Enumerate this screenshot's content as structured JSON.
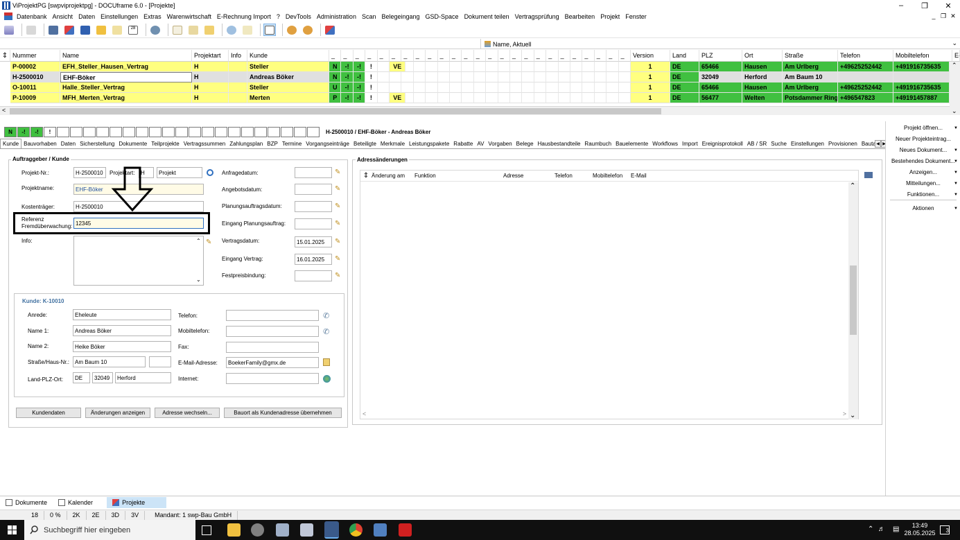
{
  "window": {
    "title": "ViProjektPG [swpviprojektpg] - DOCUframe 6.0 - [Projekte]"
  },
  "menu": [
    "Datenbank",
    "Ansicht",
    "Daten",
    "Einstellungen",
    "Extras",
    "Warenwirtschaft",
    "E-Rechnung Import",
    "?",
    "DevTools",
    "Administration",
    "Scan",
    "Belegeingang",
    "GSD-Space",
    "Dokument teilen",
    "Vertragsprüfung",
    "Bearbeiten",
    "Projekt",
    "Fenster"
  ],
  "view": {
    "selected": "Name, Aktuell"
  },
  "grid": {
    "columns": [
      "Nummer",
      "Name",
      "Projektart",
      "Info",
      "Kunde",
      "Version",
      "Land",
      "PLZ",
      "Ort",
      "Straße",
      "Telefon",
      "Mobiltelefon",
      "E-"
    ],
    "flagcols": [
      "_",
      "_",
      "_",
      "_",
      "_",
      "_",
      "_",
      "_",
      "_",
      "_",
      "_",
      "_",
      "_",
      "_",
      "_",
      "_",
      "_",
      "_",
      "_",
      "_",
      "_",
      "_",
      "_",
      "_",
      "_"
    ],
    "rows": [
      {
        "nummer": "P-00002",
        "name": "EFH_Steller_Hausen_Vertrag",
        "art": "H",
        "kunde": "Steller",
        "s1": "N",
        "s2": "-!",
        "s3": "-!",
        "s4": "!",
        "ve": "VE",
        "version": "1",
        "land": "DE",
        "plz": "65466",
        "ort": "Hausen",
        "strasse": "Am Urlberg",
        "telefon": "+49625252442",
        "mobil": "+491916735635"
      },
      {
        "nummer": "H-2500010",
        "name": "EHF-Böker",
        "art": "H",
        "kunde": "Andreas Böker",
        "s1": "N",
        "s2": "-!",
        "s3": "-!",
        "s4": "!",
        "ve": "",
        "version": "1",
        "land": "DE",
        "plz": "32049",
        "ort": "Herford",
        "strasse": "Am Baum 10",
        "telefon": "",
        "mobil": ""
      },
      {
        "nummer": "O-10011",
        "name": "Halle_Steller_Vertrag",
        "art": "H",
        "kunde": "Steller",
        "s1": "U",
        "s2": "-!",
        "s3": "-!",
        "s4": "!",
        "ve": "",
        "version": "1",
        "land": "DE",
        "plz": "65466",
        "ort": "Hausen",
        "strasse": "Am Urlberg",
        "telefon": "+49625252442",
        "mobil": "+491916735635"
      },
      {
        "nummer": "P-10009",
        "name": "MFH_Merten_Vertrag",
        "art": "H",
        "kunde": "Merten",
        "s1": "P",
        "s2": "-!",
        "s3": "-!",
        "s4": "!",
        "ve": "VE",
        "version": "1",
        "land": "DE",
        "plz": "56477",
        "ort": "Welten",
        "strasse": "Potsdammer Ring",
        "telefon": "+496547823",
        "mobil": "+49191457887"
      }
    ]
  },
  "status": {
    "flags": [
      "N",
      "-!",
      "-!",
      "!"
    ],
    "record": "H-2500010 / EHF-Böker - Andreas Böker"
  },
  "tabs": [
    "Kunde",
    "Bauvorhaben",
    "Daten",
    "Sicherstellung",
    "Dokumente",
    "Teilprojekte",
    "Vertragssummen",
    "Zahlungsplan",
    "BZP",
    "Termine",
    "Vorgangseinträge",
    "Beteiligte",
    "Merkmale",
    "Leistungspakete",
    "Rabatte",
    "AV",
    "Vorgaben",
    "Belege",
    "Hausbestandteile",
    "Raumbuch",
    "Bauelemente",
    "Workflows",
    "Import",
    "Ereignisprotokoll",
    "AB / SR",
    "Suche",
    "Einstellungen",
    "Provisionen",
    "Bautagebuch"
  ],
  "auftrag": {
    "title": "Auftraggeber / Kunde",
    "projektnr_label": "Projekt-Nr.:",
    "projektnr": "H-2500010",
    "projektart_label": "Projektart:",
    "projektart": "H",
    "projektart_name": "Projekt",
    "projektname_label": "Projektname:",
    "projektname": "EHF-Böker",
    "kostentraeger_label": "Kostenträger:",
    "kostentraeger": "H-2500010",
    "referenz_label1": "Referenz",
    "referenz_label2": "Fremdüberwachung:",
    "referenz": "12345",
    "info_label": "Info:",
    "anfrage_label": "Anfragedatum:",
    "anfrage": "",
    "angebot_label": "Angebotsdatum:",
    "angebot": "",
    "planung_label": "Planungsauftragsdatum:",
    "planung": "",
    "eingang_planung_label": "Eingang Planungsauftrag:",
    "eingang_planung": "",
    "vertrag_label": "Vertragsdatum:",
    "vertrag": "15.01.2025",
    "eingang_vertrag_label": "Eingang Vertrag:",
    "eingang_vertrag": "16.01.2025",
    "festpreis_label": "Festpreisbindung:",
    "festpreis": ""
  },
  "kunde": {
    "title": "Kunde: K-10010",
    "anrede_label": "Anrede:",
    "anrede": "Eheleute",
    "name1_label": "Name 1:",
    "name1": "Andreas Böker",
    "name2_label": "Name 2:",
    "name2": "Heike Böker",
    "strasse_label": "Straße/Haus-Nr.:",
    "strasse": "Am Baum 10",
    "hausnr": "",
    "lpo_label": "Land-PLZ-Ort:",
    "land": "DE",
    "plz": "32049",
    "ort": "Herford",
    "telefon_label": "Telefon:",
    "telefon": "",
    "mobil_label": "Mobiltelefon:",
    "mobil": "",
    "fax_label": "Fax:",
    "fax": "",
    "email_label": "E-Mail-Adresse:",
    "email": "BoekerFamily@gmx.de",
    "internet_label": "Internet:",
    "internet": ""
  },
  "buttons": {
    "kundendaten": "Kundendaten",
    "aenderungen": "Änderungen anzeigen",
    "adresse": "Adresse wechseln...",
    "bauort": "Bauort als Kundenadresse übernehmen"
  },
  "adress": {
    "title": "Adressänderungen",
    "cols": [
      "Änderung am",
      "Funktion",
      "Adresse",
      "Telefon",
      "Mobiltelefon",
      "E-Mail"
    ]
  },
  "actions": [
    "Projekt öffnen...",
    "Neuer Projekteintrag...",
    "Neues Dokument...",
    "Bestehendes Dokument...",
    "Anzeigen...",
    "Mitteilungen...",
    "Funktionen...",
    "Aktionen"
  ],
  "bottomtabs": [
    "Dokumente",
    "Kalender",
    "Projekte"
  ],
  "statusbar": [
    "18",
    "0 %",
    "2K",
    "2E",
    "3D",
    "3V",
    "Mandant: 1 swp-Bau GmbH"
  ],
  "taskbar": {
    "search": "Suchbegriff hier eingeben",
    "time": "13:49",
    "date": "28.05.2025",
    "notif": "3"
  },
  "colors": {
    "yellow": "#ffff80",
    "green": "#40c040",
    "accent": "#cce4f7"
  }
}
